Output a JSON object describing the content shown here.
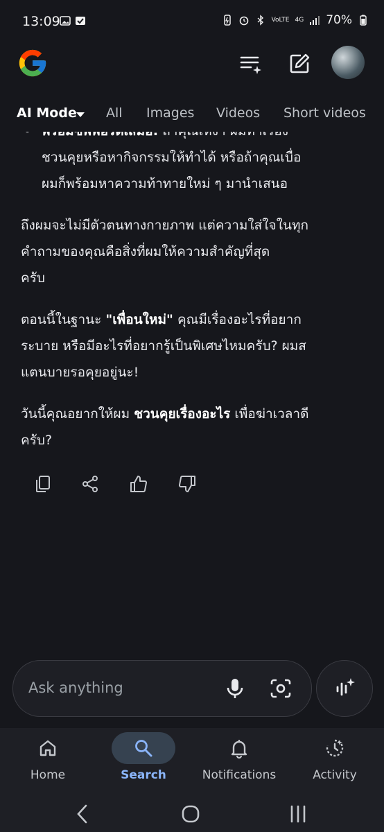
{
  "status_bar": {
    "time": "13:09",
    "battery_percent": "70%",
    "network": "4G",
    "volte": "VoLTE"
  },
  "header": {
    "logo": "google-g-logo",
    "icons": [
      "search-history-icon",
      "edit-icon"
    ],
    "avatar": "user-avatar"
  },
  "tabs": [
    {
      "label": "AI Mode",
      "active": true
    },
    {
      "label": "All"
    },
    {
      "label": "Images"
    },
    {
      "label": "Videos"
    },
    {
      "label": "Short videos"
    }
  ],
  "answer": {
    "bullet_partial_bold": "พร้อมซัพพอร์ตเสมอ:",
    "bullet_partial_rest": "ถ้าคุณเหงา ผมทำเรื่อง",
    "bullet_line2": "ชวนคุยหรือหากิจกรรมให้ทำได้ หรือถ้าคุณเบื่อ",
    "bullet_line3": "ผมก็พร้อมหาความท้าทายใหม่ ๆ มานำเสนอ",
    "para1_line1": "ถึงผมจะไม่มีตัวตนทางกายภาพ แต่ความใส่ใจในทุก",
    "para1_line2": "คำถามของคุณคือสิ่งที่ผมให้ความสำคัญที่สุด",
    "para1_line3": "ครับ",
    "para2_prefix": "ตอนนี้ในฐานะ ",
    "para2_bold": "\"เพื่อนใหม่\"",
    "para2_suffix": " คุณมีเรื่องอะไรที่อยาก",
    "para2_line2": "ระบาย หรือมีอะไรที่อยากรู้เป็นพิเศษไหมครับ? ผมส",
    "para2_line3": "แตนบายรอคุยอยู่นะ!",
    "para3_prefix": "วันนี้คุณอยากให้ผม ",
    "para3_bold": "ชวนคุยเรื่องอะไร",
    "para3_suffix": " เพื่อฆ่าเวลาดี",
    "para3_line2": "ครับ?"
  },
  "feedback_icons": [
    "copy-icon",
    "share-icon",
    "thumbs-up-icon",
    "thumbs-down-icon"
  ],
  "ask_bar": {
    "placeholder": "Ask anything"
  },
  "bottom_nav": [
    {
      "label": "Home"
    },
    {
      "label": "Search",
      "active": true
    },
    {
      "label": "Notifications"
    },
    {
      "label": "Activity"
    }
  ],
  "colors": {
    "background": "#16171c",
    "accent": "#8ab4f8",
    "nav_active_pill": "#364250"
  }
}
